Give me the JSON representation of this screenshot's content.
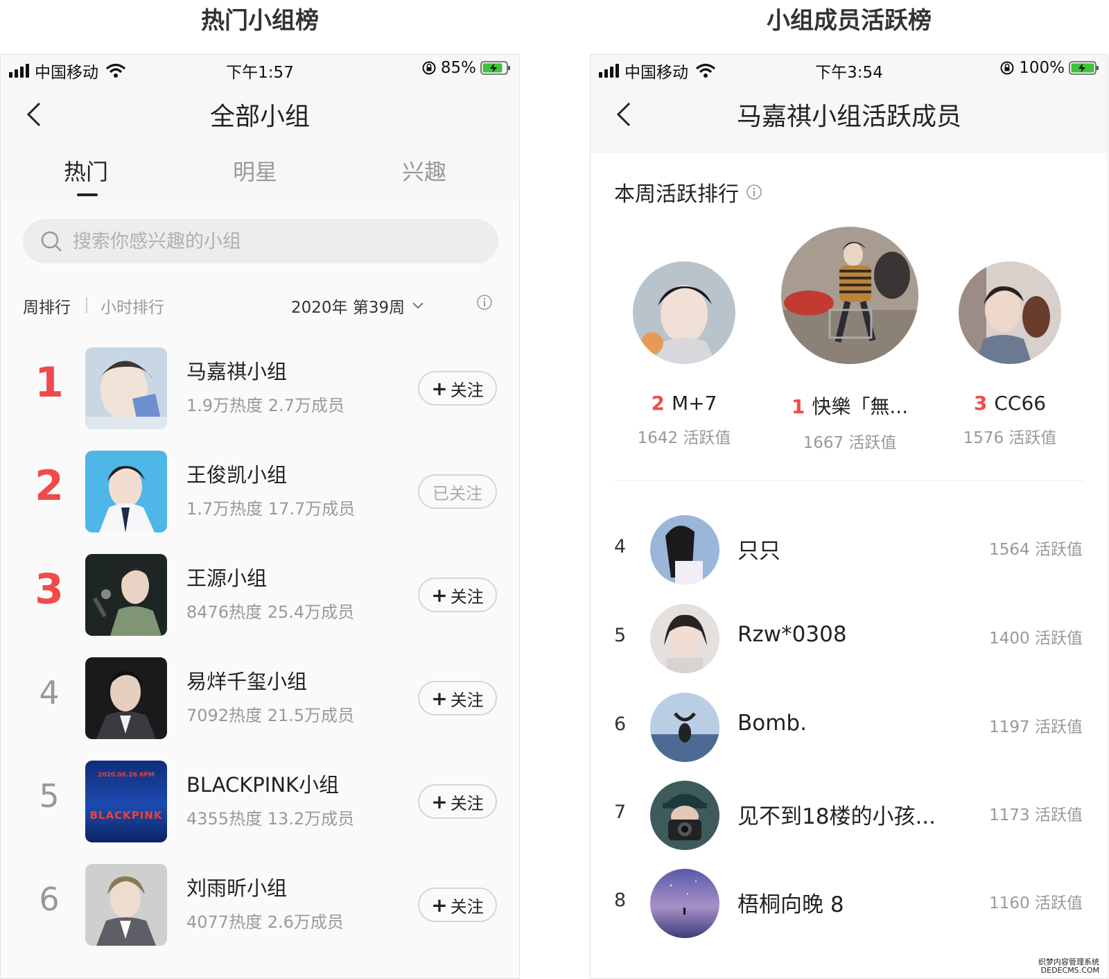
{
  "captions": {
    "left": "热门小组榜",
    "right": "小组成员活跃榜"
  },
  "left_screen": {
    "status": {
      "carrier": "中国移动",
      "time": "下午1:57",
      "battery": "85%"
    },
    "nav_title": "全部小组",
    "tabs": [
      "热门",
      "明星",
      "兴趣"
    ],
    "search_placeholder": "搜索你感兴趣的小组",
    "filter": {
      "week": "周排行",
      "hour": "小时排行",
      "period": "2020年 第39周"
    },
    "groups": [
      {
        "rank": "1",
        "name": "马嘉祺小组",
        "stats": "1.9万热度 2.7万成员",
        "button": "关注",
        "followed": false
      },
      {
        "rank": "2",
        "name": "王俊凯小组",
        "stats": "1.7万热度 17.7万成员",
        "button": "已关注",
        "followed": true
      },
      {
        "rank": "3",
        "name": "王源小组",
        "stats": "8476热度 25.4万成员",
        "button": "关注",
        "followed": false
      },
      {
        "rank": "4",
        "name": "易烊千玺小组",
        "stats": "7092热度 21.5万成员",
        "button": "关注",
        "followed": false
      },
      {
        "rank": "5",
        "name": "BLACKPINK小组",
        "stats": "4355热度 13.2万成员",
        "button": "关注",
        "followed": false
      },
      {
        "rank": "6",
        "name": "刘雨昕小组",
        "stats": "4077热度 2.6万成员",
        "button": "关注",
        "followed": false
      }
    ],
    "blackpink_poster": {
      "date": "2020.06.26 6PM",
      "logo": "BLACKPINK"
    }
  },
  "right_screen": {
    "status": {
      "carrier": "中国移动",
      "time": "下午3:54",
      "battery": "100%"
    },
    "nav_title": "马嘉祺小组活跃成员",
    "section_title": "本周活跃排行",
    "podium": [
      {
        "rank": "2",
        "name": "M+7",
        "score": "1642 活跃值"
      },
      {
        "rank": "1",
        "name": "快樂「無...",
        "score": "1667 活跃值"
      },
      {
        "rank": "3",
        "name": "CC66",
        "score": "1576 活跃值"
      }
    ],
    "members": [
      {
        "rank": "4",
        "name": "只只",
        "score": "1564 活跃值"
      },
      {
        "rank": "5",
        "name": "Rzw*0308",
        "score": "1400 活跃值"
      },
      {
        "rank": "6",
        "name": "Bomb.",
        "score": "1197 活跃值"
      },
      {
        "rank": "7",
        "name": "见不到18楼的小孩...",
        "score": "1173 活跃值"
      },
      {
        "rank": "8",
        "name": "梧桐向晚 8",
        "score": "1160 活跃值"
      }
    ]
  },
  "watermark": {
    "line1": "织梦内容管理系统",
    "line2": "DEDECMS.COM"
  },
  "colors": {
    "accent_red": "#f04a4a",
    "muted_text": "#999999"
  }
}
